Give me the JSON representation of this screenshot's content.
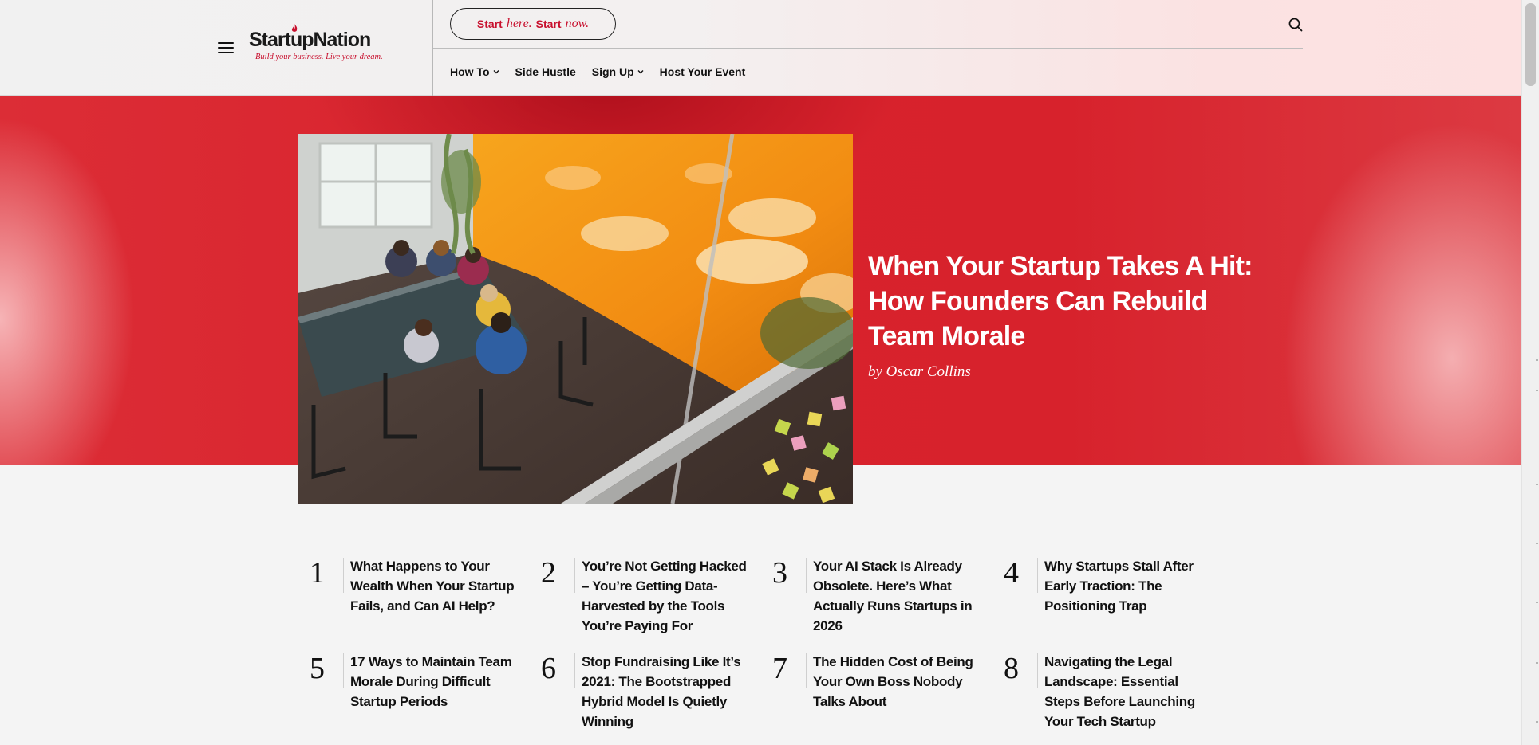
{
  "header": {
    "logo_text": "StartupNation",
    "logo_tagline": "Build your business. Live your dream.",
    "pill": {
      "part1": "Start",
      "part2": "here.",
      "part3": "Start",
      "part4": "now."
    },
    "nav": [
      {
        "label": "How To",
        "has_dropdown": true
      },
      {
        "label": "Side Hustle",
        "has_dropdown": false
      },
      {
        "label": "Sign Up",
        "has_dropdown": true
      },
      {
        "label": "Host Your Event",
        "has_dropdown": false
      }
    ],
    "icons": {
      "menu": "hamburger-menu-icon",
      "search": "search-icon",
      "dropdown": "chevron-down-icon"
    }
  },
  "hero": {
    "title": "When Your Startup Takes A Hit: How Founders Can Rebuild Team Morale",
    "byline": "by Oscar Collins",
    "image_alt": "Team meeting around a conference table in an office with orange glass walls"
  },
  "popular": [
    {
      "num": "1",
      "title": "What Happens to Your Wealth When Your Startup Fails, and Can AI Help?"
    },
    {
      "num": "2",
      "title": "You’re Not Getting Hacked – You’re Getting Data-Harvested by the Tools You’re Paying For"
    },
    {
      "num": "3",
      "title": "Your AI Stack Is Already Obsolete. Here’s What Actually Runs Startups in 2026"
    },
    {
      "num": "4",
      "title": "Why Startups Stall After Early Traction: The Positioning Trap"
    },
    {
      "num": "5",
      "title": "17 Ways to Maintain Team Morale During Difficult Startup Periods"
    },
    {
      "num": "6",
      "title": "Stop Fundraising Like It’s 2021: The Bootstrapped Hybrid Model Is Quietly Winning"
    },
    {
      "num": "7",
      "title": "The Hidden Cost of Being Your Own Boss Nobody Talks About"
    },
    {
      "num": "8",
      "title": "Navigating the Legal Landscape: Essential Steps Before Launching Your Tech Startup"
    }
  ],
  "colors": {
    "brand_red": "#c8102e",
    "hero_red": "#d8222c",
    "text": "#111111"
  }
}
